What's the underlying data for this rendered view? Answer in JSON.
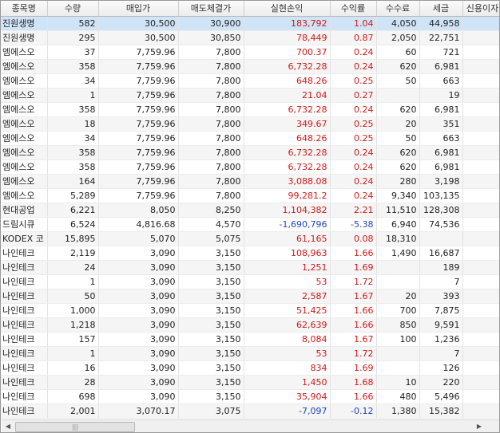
{
  "columns": [
    "종목명",
    "수량",
    "매입가",
    "매도체결가",
    "실현손익",
    "수익률",
    "수수료",
    "세금",
    "신용이자"
  ],
  "rows": [
    [
      "진원생명",
      "582",
      "30,500",
      "30,900",
      "183,792",
      "1.04",
      "4,050",
      "44,958",
      ""
    ],
    [
      "진원생명",
      "295",
      "30,500",
      "30,850",
      "78,449",
      "0.87",
      "2,050",
      "22,751",
      ""
    ],
    [
      "엠에스오",
      "37",
      "7,759.96",
      "7,800",
      "700.37",
      "0.24",
      "60",
      "721",
      ""
    ],
    [
      "엠에스오",
      "358",
      "7,759.96",
      "7,800",
      "6,732.28",
      "0.24",
      "620",
      "6,981",
      ""
    ],
    [
      "엠에스오",
      "34",
      "7,759.96",
      "7,800",
      "648.26",
      "0.25",
      "50",
      "663",
      ""
    ],
    [
      "엠에스오",
      "1",
      "7,759.96",
      "7,800",
      "21.04",
      "0.27",
      "",
      "19",
      ""
    ],
    [
      "엠에스오",
      "358",
      "7,759.96",
      "7,800",
      "6,732.28",
      "0.24",
      "620",
      "6,981",
      ""
    ],
    [
      "엠에스오",
      "18",
      "7,759.96",
      "7,800",
      "349.67",
      "0.25",
      "20",
      "351",
      ""
    ],
    [
      "엠에스오",
      "34",
      "7,759.96",
      "7,800",
      "648.26",
      "0.25",
      "50",
      "663",
      ""
    ],
    [
      "엠에스오",
      "358",
      "7,759.96",
      "7,800",
      "6,732.28",
      "0.24",
      "620",
      "6,981",
      ""
    ],
    [
      "엠에스오",
      "358",
      "7,759.96",
      "7,800",
      "6,732.28",
      "0.24",
      "620",
      "6,981",
      ""
    ],
    [
      "엠에스오",
      "164",
      "7,759.96",
      "7,800",
      "3,088.08",
      "0.24",
      "280",
      "3,198",
      ""
    ],
    [
      "엠에스오",
      "5,289",
      "7,759.96",
      "7,800",
      "99,281.2",
      "0.24",
      "9,340",
      "103,135",
      ""
    ],
    [
      "현대공업",
      "6,221",
      "8,050",
      "8,250",
      "1,104,382",
      "2.21",
      "11,510",
      "128,308",
      ""
    ],
    [
      "드림시큐",
      "6,524",
      "4,816.68",
      "4,570",
      "-1,690,796",
      "-5.38",
      "6,940",
      "74,536",
      ""
    ],
    [
      "KODEX 코",
      "15,895",
      "5,070",
      "5,075",
      "61,165",
      "0.08",
      "18,310",
      "",
      ""
    ],
    [
      "나인테크",
      "2,119",
      "3,090",
      "3,150",
      "108,963",
      "1.66",
      "1,490",
      "16,687",
      ""
    ],
    [
      "나인테크",
      "24",
      "3,090",
      "3,150",
      "1,251",
      "1.69",
      "",
      "189",
      ""
    ],
    [
      "나인테크",
      "1",
      "3,090",
      "3,150",
      "53",
      "1.72",
      "",
      "7",
      ""
    ],
    [
      "나인테크",
      "50",
      "3,090",
      "3,150",
      "2,587",
      "1.67",
      "20",
      "393",
      ""
    ],
    [
      "나인테크",
      "1,000",
      "3,090",
      "3,150",
      "51,425",
      "1.66",
      "700",
      "7,875",
      ""
    ],
    [
      "나인테크",
      "1,218",
      "3,090",
      "3,150",
      "62,639",
      "1.66",
      "850",
      "9,591",
      ""
    ],
    [
      "나인테크",
      "157",
      "3,090",
      "3,150",
      "8,084",
      "1.67",
      "100",
      "1,236",
      ""
    ],
    [
      "나인테크",
      "1",
      "3,090",
      "3,150",
      "53",
      "1.72",
      "",
      "7",
      ""
    ],
    [
      "나인테크",
      "16",
      "3,090",
      "3,150",
      "834",
      "1.69",
      "",
      "126",
      ""
    ],
    [
      "나인테크",
      "28",
      "3,090",
      "3,150",
      "1,450",
      "1.68",
      "10",
      "220",
      ""
    ],
    [
      "나인테크",
      "698",
      "3,090",
      "3,150",
      "35,904",
      "1.66",
      "480",
      "5,496",
      ""
    ],
    [
      "나인테크",
      "2,001",
      "3,070.17",
      "3,075",
      "-7,097",
      "-0.12",
      "1,380",
      "15,382",
      ""
    ]
  ],
  "scrollbar": {
    "left_arrow": "◀",
    "right_arrow": "▶",
    "thumb_grip": "|||"
  },
  "colors": {
    "positive": "#d01818",
    "negative": "#1f45c8",
    "selected_row": "#cfe4f7"
  }
}
